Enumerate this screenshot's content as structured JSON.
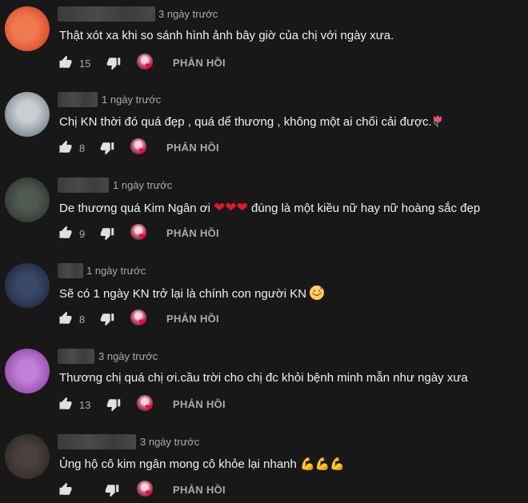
{
  "comments": [
    {
      "time": "3 ngày trước",
      "text": "Thật xót xa khi so sánh hình ảnh bây giờ của chị với ngày xưa.",
      "likes": "15",
      "reply_label": "PHẢN HỒI",
      "avatar_color": "#e8603a"
    },
    {
      "time": "1 ngày trước",
      "text": "Chị KN thời đó quá đẹp , quá dể thương , không  một  ai chối cải được.",
      "likes": "8",
      "reply_label": "PHẢN HỒI",
      "emoji": "tulip-icon",
      "avatar_color": "#9aa4ac"
    },
    {
      "time": "1 ngày trước",
      "text_before": "De thương quá Kim Ngân ơi ",
      "text_after": " đúng là một kiều nữ hay nữ hoàng sắc đẹp",
      "hearts": [
        "❤",
        "❤",
        "❤"
      ],
      "likes": "9",
      "reply_label": "PHẢN HỒI",
      "avatar_color": "#3e4640"
    },
    {
      "time": "1 ngày trước",
      "text": "Sẽ có 1 ngày KN trở lại là chính con người KN ",
      "likes": "8",
      "reply_label": "PHẢN HỒI",
      "emoji": "smiling-face-with-hearts-icon",
      "avatar_color": "#2a3550"
    },
    {
      "time": "3 ngày trước",
      "text": "Thương chị quá chị ơi.cầu trời cho chị đc khỏi bệnh minh mẫn như ngày xưa",
      "likes": "13",
      "reply_label": "PHẢN HỒI",
      "avatar_color": "#a35ab8"
    },
    {
      "time": "3 ngày trước",
      "text": "Ủng hộ cô kim ngân mong cô khỏe lại nhanh ",
      "arms": [
        "💪",
        "💪",
        "💪"
      ],
      "likes": "",
      "reply_label": "PHẢN HỒI",
      "avatar_color": "#3a3230"
    }
  ]
}
